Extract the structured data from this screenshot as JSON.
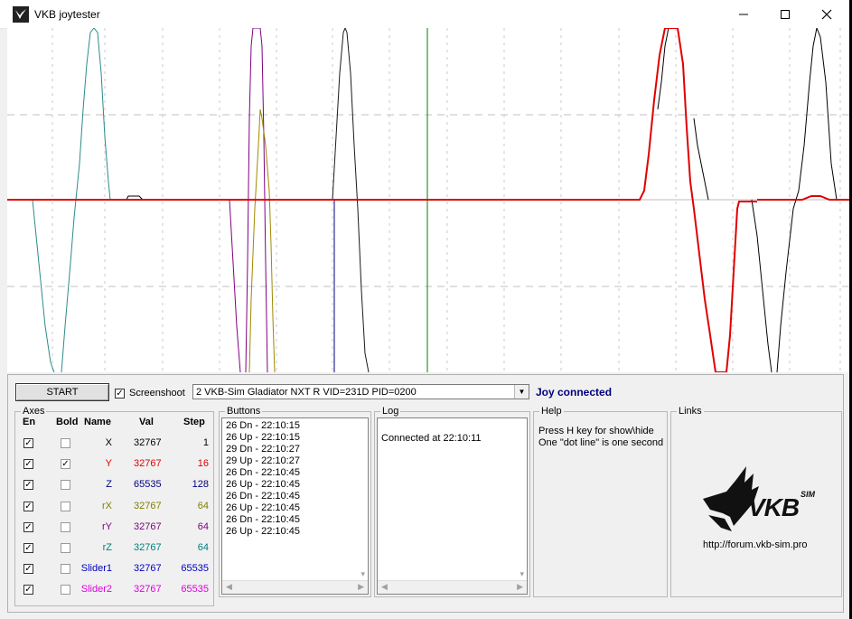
{
  "window": {
    "title": "VKB joytester"
  },
  "controls": {
    "start_label": "START",
    "screenshoot_label": "Screenshoot",
    "screenshoot_checked": true,
    "device": "2  VKB-Sim Gladiator NXT R   VID=231D PID=0200",
    "status": "Joy connected"
  },
  "axes": {
    "title": "Axes",
    "headers": {
      "en": "En",
      "bold": "Bold",
      "name": "Name",
      "val": "Val",
      "step": "Step"
    },
    "rows": [
      {
        "name": "X",
        "val": "32767",
        "step": "1",
        "color": "#000000",
        "en": true,
        "bold": false
      },
      {
        "name": "Y",
        "val": "32767",
        "step": "16",
        "color": "#e00000",
        "en": true,
        "bold": true
      },
      {
        "name": "Z",
        "val": "65535",
        "step": "128",
        "color": "#000080",
        "en": true,
        "bold": false
      },
      {
        "name": "rX",
        "val": "32767",
        "step": "64",
        "color": "#808000",
        "en": true,
        "bold": false
      },
      {
        "name": "rY",
        "val": "32767",
        "step": "64",
        "color": "#800080",
        "en": true,
        "bold": false
      },
      {
        "name": "rZ",
        "val": "32767",
        "step": "64",
        "color": "#008080",
        "en": true,
        "bold": false
      },
      {
        "name": "Slider1",
        "val": "32767",
        "step": "65535",
        "color": "#0000c0",
        "en": true,
        "bold": false
      },
      {
        "name": "Slider2",
        "val": "32767",
        "step": "65535",
        "color": "#e000e0",
        "en": true,
        "bold": false
      }
    ]
  },
  "buttons": {
    "title": "Buttons",
    "lines": [
      "26 Dn - 22:10:15",
      "26 Up - 22:10:15",
      "29 Dn - 22:10:27",
      "29 Up - 22:10:27",
      "26 Dn - 22:10:45",
      "26 Up - 22:10:45",
      "26 Dn - 22:10:45",
      "26 Up - 22:10:45",
      "26 Dn - 22:10:45",
      "26 Up - 22:10:45"
    ]
  },
  "log": {
    "title": "Log",
    "text": "Connected at 22:10:11"
  },
  "help": {
    "title": "Help",
    "line1": "Press H key for show\\hide",
    "line2": "One \"dot line\" is one second"
  },
  "links": {
    "title": "Links",
    "logo_text": "VKB",
    "logo_sup": "SIM",
    "url": "http://forum.vkb-sim.pro"
  }
}
